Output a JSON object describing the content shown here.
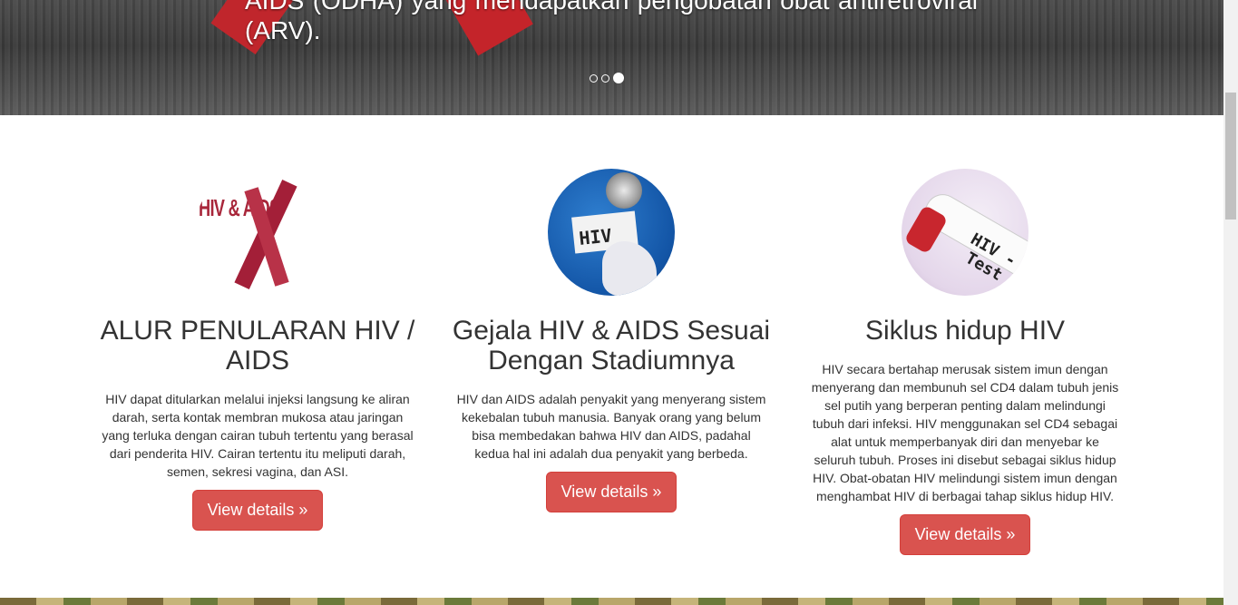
{
  "carousel": {
    "caption": "AIDS (ODHA) yang mendapatkan pengobatan obat antiretroviral (ARV).",
    "indicator_count": 3,
    "active_indicator": 3
  },
  "features": [
    {
      "title": "ALUR PENULARAN HIV / AIDS",
      "text": "HIV dapat ditularkan melalui injeksi langsung ke aliran darah, serta kontak membran mukosa atau jaringan yang terluka dengan cairan tubuh tertentu yang berasal dari penderita HIV. Cairan tertentu itu meliputi darah, semen, sekresi vagina, dan ASI.",
      "button": "View details »",
      "image_text": "HIV & AIDS"
    },
    {
      "title": "Gejala HIV & AIDS Sesuai Dengan Stadiumnya",
      "text": "HIV dan AIDS adalah penyakit yang menyerang sistem kekebalan tubuh manusia. Banyak orang yang belum bisa membedakan bahwa HIV dan AIDS, padahal kedua hal ini adalah dua penyakit yang berbeda.",
      "button": "View details »",
      "image_text": "HIV"
    },
    {
      "title": "Siklus hidup HIV",
      "text": "HIV secara bertahap merusak sistem imun dengan menyerang dan membunuh sel CD4 dalam tubuh jenis sel putih yang berperan penting dalam melindungi tubuh dari infeksi. HIV menggunakan sel CD4 sebagai alat untuk memperbanyak diri dan menyebar ke seluruh tubuh. Proses ini disebut sebagai siklus hidup HIV. Obat-obatan HIV melindungi sistem imun dengan menghambat HIV di berbagai tahap siklus hidup HIV.",
      "button": "View details »",
      "image_text": "HIV - Test"
    }
  ],
  "colors": {
    "button": "#d9534f",
    "ribbon": "#c0262c"
  }
}
